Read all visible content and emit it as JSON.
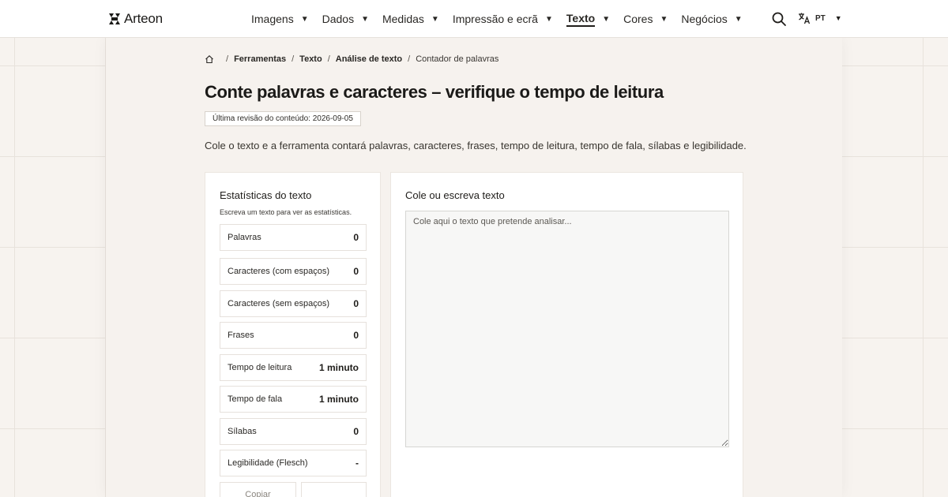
{
  "brand": {
    "name": "Arteon"
  },
  "nav": {
    "items": [
      {
        "label": "Imagens",
        "active": false
      },
      {
        "label": "Dados",
        "active": false
      },
      {
        "label": "Medidas",
        "active": false
      },
      {
        "label": "Impressão e ecrã",
        "active": false
      },
      {
        "label": "Texto",
        "active": true
      },
      {
        "label": "Cores",
        "active": false
      },
      {
        "label": "Negócios",
        "active": false
      }
    ],
    "caret": "▼",
    "search_icon": "search-icon",
    "language": {
      "icon": "translate-icon",
      "code": "PT"
    }
  },
  "breadcrumb": {
    "home_icon": "home-icon",
    "separator": "/",
    "links": [
      "Ferramentas",
      "Texto",
      "Análise de texto"
    ],
    "current": "Contador de palavras"
  },
  "page": {
    "title": "Conte palavras e caracteres – verifique o tempo de leitura",
    "review": "Última revisão do conteúdo: 2026-09-05",
    "intro": "Cole o texto e a ferramenta contará palavras, caracteres, frases, tempo de leitura, tempo de fala, sílabas e legibilidade."
  },
  "stats": {
    "title": "Estatísticas do texto",
    "hint": "Escreva um texto para ver as estatísticas.",
    "rows": [
      {
        "label": "Palavras",
        "value": "0"
      },
      {
        "label": "Caracteres (com espaços)",
        "value": "0"
      },
      {
        "label": "Caracteres (sem espaços)",
        "value": "0"
      },
      {
        "label": "Frases",
        "value": "0"
      },
      {
        "label": "Tempo de leitura",
        "value": "1 minuto"
      },
      {
        "label": "Tempo de fala",
        "value": "1 minuto"
      },
      {
        "label": "Sílabas",
        "value": "0"
      },
      {
        "label": "Legibilidade (Flesch)",
        "value": "-"
      }
    ],
    "copy_label": "Copiar",
    "second_button_label": ""
  },
  "editor": {
    "title": "Cole ou escreva texto",
    "placeholder": "Cole aqui o texto que pretende analisar...",
    "value": ""
  },
  "colors": {
    "background": "#f7f3ef",
    "panel": "#f6f2ee",
    "card": "#ffffff",
    "text": "#1f1d1a",
    "textarea": "#f7f7f6"
  }
}
